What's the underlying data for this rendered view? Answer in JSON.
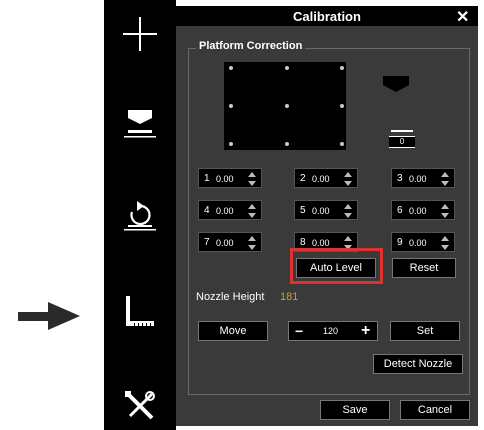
{
  "toolbar": {
    "items": [
      {
        "icon": "plus-icon"
      },
      {
        "icon": "platform-nozzle-icon"
      },
      {
        "icon": "rotate-icon"
      },
      {
        "icon": "ruler-icon"
      },
      {
        "icon": "tools-icon"
      }
    ]
  },
  "pointer": {
    "icon": "arrow-right-icon"
  },
  "dialog": {
    "title": "Calibration",
    "close_label": "✕",
    "group_title": "Platform Correction",
    "grid_scale_value": "0",
    "points": [
      {
        "n": "1",
        "v": "0.00"
      },
      {
        "n": "2",
        "v": "0.00"
      },
      {
        "n": "3",
        "v": "0.00"
      },
      {
        "n": "4",
        "v": "0.00"
      },
      {
        "n": "5",
        "v": "0.00"
      },
      {
        "n": "6",
        "v": "0.00"
      },
      {
        "n": "7",
        "v": "0.00"
      },
      {
        "n": "8",
        "v": "0.00"
      },
      {
        "n": "9",
        "v": "0.00"
      }
    ],
    "auto_level_label": "Auto Level",
    "reset_label": "Reset",
    "nozzle_height_label": "Nozzle Height",
    "nozzle_height_value": "181",
    "move_label": "Move",
    "minus_label": "−",
    "step_value": "120",
    "plus_label": "+",
    "set_label": "Set",
    "detect_nozzle_label": "Detect Nozzle",
    "save_label": "Save",
    "cancel_label": "Cancel"
  },
  "colors": {
    "accent_highlight": "#e03030",
    "nozzle_height_value": "#d8a000"
  }
}
